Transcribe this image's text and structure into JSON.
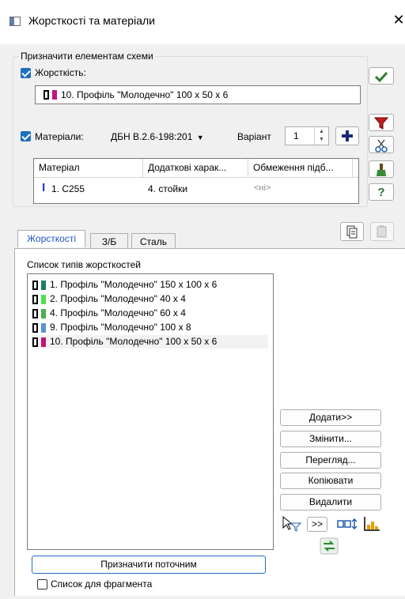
{
  "window": {
    "title": "Жорсткості та матеріали",
    "close_label": "✕"
  },
  "assign_group": {
    "legend": "Призначити елементам схеми",
    "stiffness_label": "Жорсткість:",
    "stiffness_value": "10. Профіль \"Молодечно\" 100 x 50 x 6",
    "stiffness_color": "#c0157a",
    "materials_label": "Матеріали:",
    "materials_norm": "ДБН В.2.6-198:201",
    "variant_label": "Варіант",
    "variant_value": "1"
  },
  "materials_table": {
    "columns": [
      "Матеріал",
      "Додаткові харак...",
      "Обмеження підб..."
    ],
    "rows": [
      {
        "material": "1. C255",
        "extra": "4. стойки",
        "limit": "<ні>"
      }
    ]
  },
  "tabs": [
    {
      "label": "Жорсткості",
      "active": true
    },
    {
      "label": "З/Б",
      "active": false
    },
    {
      "label": "Сталь",
      "active": false
    }
  ],
  "stiffness_list": {
    "label": "Список типів жорсткостей",
    "items": [
      {
        "label": "1. Профіль \"Молодечно\" 150 x 100 x 6",
        "color": "#1a7d6a"
      },
      {
        "label": "2. Профіль \"Молодечно\" 40 x 4",
        "color": "#4fe04f"
      },
      {
        "label": "4. Профіль \"Молодечно\" 60 x 4",
        "color": "#4cae4c"
      },
      {
        "label": "9. Профіль \"Молодечно\" 100 x 8",
        "color": "#5a92d2"
      },
      {
        "label": "10. Профіль \"Молодечно\" 100 x 50 x 6",
        "color": "#c0157a"
      }
    ]
  },
  "actions": {
    "add": "Додати>>",
    "edit": "Змінити...",
    "view": "Перегляд...",
    "copy": "Копіювати",
    "delete": "Видалити",
    "more": ">>"
  },
  "bottom": {
    "assign_current": "Призначити поточним",
    "fragment_list": "Список для фрагмента"
  }
}
